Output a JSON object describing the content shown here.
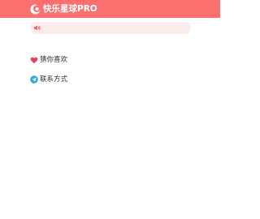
{
  "header": {
    "title": "快乐星球PRO",
    "logo_icon": "crescent-moon-logo-icon",
    "background_color": "#fb6f6f"
  },
  "notice": {
    "icon": "speaker-icon",
    "text": "",
    "background_color": "#fdecec",
    "accent_color": "#f0605f"
  },
  "menu": {
    "items": [
      {
        "label": "猜你喜欢",
        "icon": "heart-icon",
        "icon_color": "#e8405a"
      },
      {
        "label": "联系方式",
        "icon": "telegram-icon",
        "icon_color": "#2ea6de"
      }
    ]
  }
}
